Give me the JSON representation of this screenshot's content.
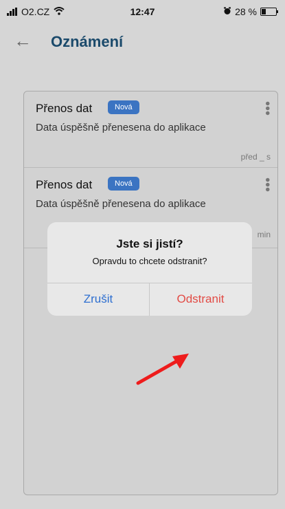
{
  "status_bar": {
    "carrier": "O2.CZ",
    "time": "12:47",
    "battery": "28 %",
    "battery_fraction": 0.28
  },
  "header": {
    "title": "Oznámení"
  },
  "notifications": [
    {
      "title": "Přenos dat",
      "badge": "Nová",
      "body": "Data úspěšně přenesena do aplikace",
      "time": "před _ s"
    },
    {
      "title": "Přenos dat",
      "badge": "Nová",
      "body": "Data úspěšně přenesena do aplikace",
      "time": "min"
    }
  ],
  "dialog": {
    "title": "Jste si jistí?",
    "message": "Opravdu to chcete odstranit?",
    "cancel_label": "Zrušit",
    "confirm_label": "Odstranit"
  },
  "colors": {
    "title_blue": "#1b4a6b",
    "badge_blue": "#3b74c2",
    "cancel_blue": "#2e6fd0",
    "destructive_red": "#e24b45",
    "annotation_red": "#ee1c1c"
  },
  "icons": [
    "signal-icon",
    "wifi-icon",
    "alarm-icon",
    "battery-icon",
    "back-arrow-icon",
    "more-vertical-icon",
    "annotation-arrow-icon"
  ]
}
